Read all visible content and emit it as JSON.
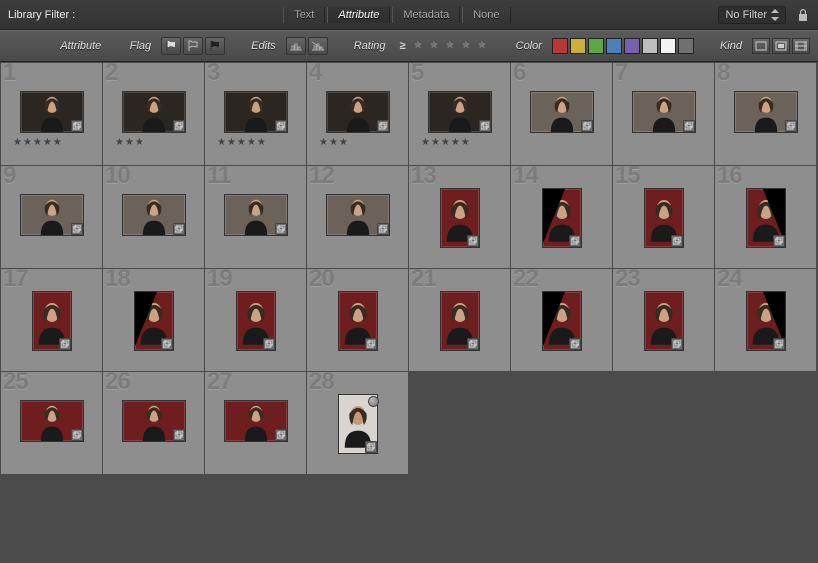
{
  "filterbar": {
    "title": "Library Filter :",
    "tabs": [
      "Text",
      "Attribute",
      "Metadata",
      "None"
    ],
    "active_tab": "Attribute",
    "nofilter_label": "No Filter"
  },
  "attrbar": {
    "label": "Attribute",
    "flag_label": "Flag",
    "edits_label": "Edits",
    "rating_label": "Rating",
    "color_label": "Color",
    "kind_label": "Kind",
    "rating_op": "≥",
    "color_swatches": [
      "#b63a34",
      "#c9b23c",
      "#5ea843",
      "#4f7fb8",
      "#7a5fae",
      "#bdbdbd",
      "#f2f2f2",
      "#707070"
    ]
  },
  "thumbs": [
    {
      "n": 1,
      "bg": "dark",
      "orient": "land",
      "stars": 5
    },
    {
      "n": 2,
      "bg": "dark",
      "orient": "land",
      "stars": 3
    },
    {
      "n": 3,
      "bg": "dark",
      "orient": "land",
      "stars": 5
    },
    {
      "n": 4,
      "bg": "dark",
      "orient": "land",
      "stars": 3
    },
    {
      "n": 5,
      "bg": "dark",
      "orient": "land",
      "stars": 5
    },
    {
      "n": 6,
      "bg": "gray",
      "orient": "land",
      "stars": 0
    },
    {
      "n": 7,
      "bg": "gray",
      "orient": "land",
      "stars": 0
    },
    {
      "n": 8,
      "bg": "gray",
      "orient": "land",
      "stars": 0
    },
    {
      "n": 9,
      "bg": "gray",
      "orient": "land",
      "stars": 0
    },
    {
      "n": 10,
      "bg": "gray",
      "orient": "land",
      "stars": 0
    },
    {
      "n": 11,
      "bg": "gray",
      "orient": "land",
      "stars": 0
    },
    {
      "n": 12,
      "bg": "gray",
      "orient": "land",
      "stars": 0
    },
    {
      "n": 13,
      "bg": "red",
      "orient": "port",
      "stars": 0
    },
    {
      "n": 14,
      "bg": "red",
      "orient": "port",
      "wedge": "tl",
      "stars": 0
    },
    {
      "n": 15,
      "bg": "red",
      "orient": "port",
      "stars": 0
    },
    {
      "n": 16,
      "bg": "red",
      "orient": "port",
      "wedge": "tr",
      "stars": 0
    },
    {
      "n": 17,
      "bg": "red",
      "orient": "port",
      "stars": 0
    },
    {
      "n": 18,
      "bg": "red",
      "orient": "port",
      "wedge": "tl",
      "stars": 0
    },
    {
      "n": 19,
      "bg": "red",
      "orient": "port",
      "stars": 0
    },
    {
      "n": 20,
      "bg": "red",
      "orient": "port",
      "stars": 0
    },
    {
      "n": 21,
      "bg": "red",
      "orient": "port",
      "stars": 0
    },
    {
      "n": 22,
      "bg": "red",
      "orient": "port",
      "wedge": "tl",
      "stars": 0
    },
    {
      "n": 23,
      "bg": "red",
      "orient": "port",
      "stars": 0
    },
    {
      "n": 24,
      "bg": "red",
      "orient": "port",
      "wedge": "tr",
      "stars": 0
    },
    {
      "n": 25,
      "bg": "red",
      "orient": "land",
      "stars": 0
    },
    {
      "n": 26,
      "bg": "red",
      "orient": "land",
      "stars": 0
    },
    {
      "n": 27,
      "bg": "red",
      "orient": "land",
      "stars": 0
    },
    {
      "n": 28,
      "bg": "white",
      "orient": "port",
      "dot": true,
      "stars": 0
    }
  ]
}
